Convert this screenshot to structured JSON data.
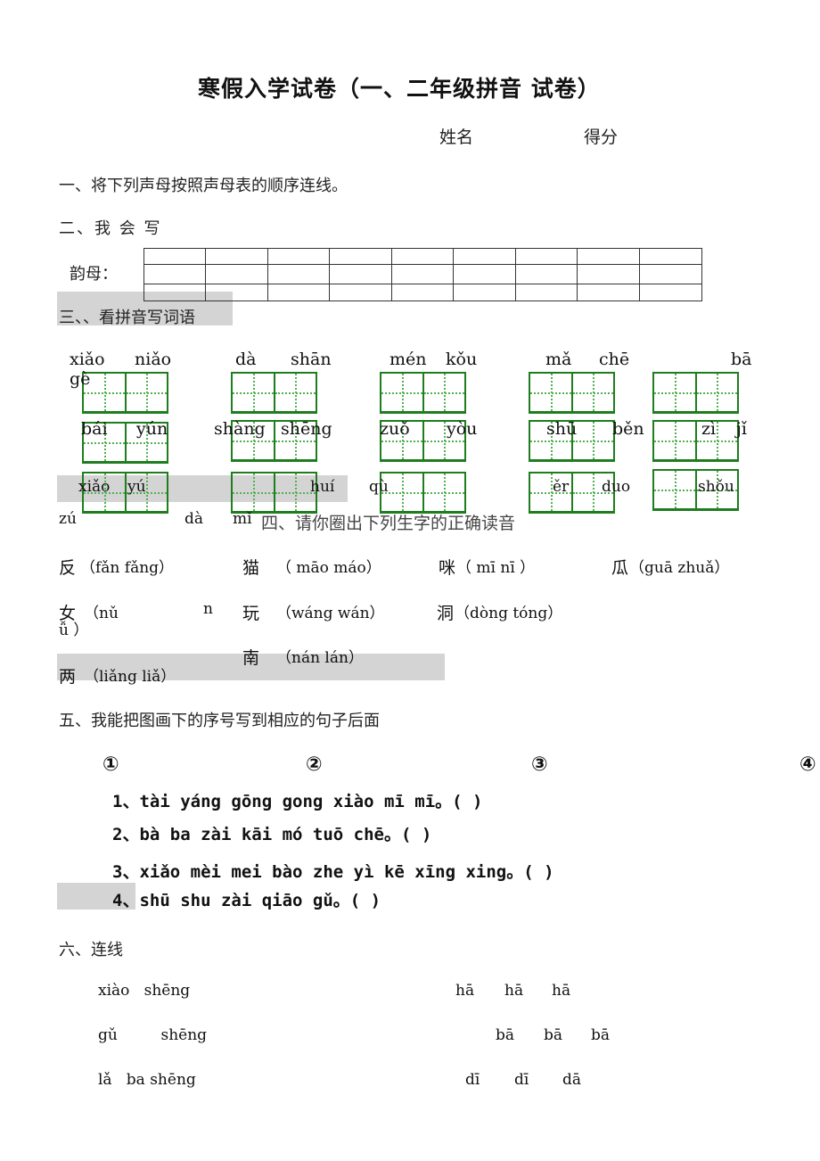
{
  "header": {
    "title": "寒假入学试卷（一、二年级拼音 试卷）",
    "name_label": "姓名",
    "score_label": "得分"
  },
  "section1": {
    "heading": "一、将下列声母按照声母表的顺序连线。"
  },
  "section2": {
    "heading": "二、我 会 写",
    "row_label": "韵母：",
    "grid_columns": 9,
    "grid_rows": 3
  },
  "section3": {
    "heading": "三、、看拼音写词语",
    "pinyin_rows": [
      [
        "xiǎo",
        "niǎo",
        "dà",
        "shān",
        "mén",
        "kǒu",
        "mǎ",
        "chē",
        "bā",
        "gè"
      ],
      [
        "bái",
        "yún",
        "shàng",
        "shēng",
        "zuǒ",
        "yòu",
        "shū",
        "běn",
        "zì",
        "jǐ"
      ],
      [
        "xiǎo",
        "yú",
        "huí",
        "qù",
        "ěr",
        "duo",
        "shǒu",
        "zú",
        "dà",
        "mǐ"
      ]
    ]
  },
  "section4": {
    "heading": "四、请你圈出下列生字的正确读音",
    "items": [
      {
        "char": "反",
        "options": "（fǎn  fǎng）"
      },
      {
        "char": "猫",
        "options": "（ māo  máo）"
      },
      {
        "char": "咪",
        "options": "（ mī   nī ）"
      },
      {
        "char": "瓜",
        "options": "（guā zhuǎ）"
      },
      {
        "char": "女",
        "options_a": "（nǔ",
        "options_b": "n",
        "options_c": "ǚ ）"
      },
      {
        "char": "玩",
        "options": "（wáng    wán）"
      },
      {
        "char": "洞",
        "options": "（dòng   tóng）"
      },
      {
        "char": "南",
        "options": "（nán   lán）"
      },
      {
        "char": "两",
        "options": "（liǎng   liǎ）"
      }
    ]
  },
  "section5": {
    "heading": "五、我能把图画下的序号写到相应的句子后面",
    "markers": [
      "①",
      "②",
      "③",
      "④"
    ],
    "sentences": [
      "1、tài yáng gōng gong xiào mī mī。(     )",
      "2、bà ba zài kāi mó tuō chē。(         )",
      "3、xiǎo mèi mei bào zhe yì kē xīng xing。(        )",
      "4、shū shu zài qiāo gǔ。(        )"
    ]
  },
  "section6": {
    "heading": "六、连线",
    "left": [
      "xiào   shēng",
      "gǔ         shēng",
      "lǎ   ba shēng"
    ],
    "right": [
      [
        "hā",
        "hā",
        "hā"
      ],
      [
        "bā",
        "bā",
        "bā"
      ],
      [
        "dī",
        "dī",
        "dā"
      ]
    ]
  },
  "colors": {
    "grid_green": "#1e7d1e",
    "guide_green": "#52b052",
    "shade_gray": "#d4d4d4"
  }
}
